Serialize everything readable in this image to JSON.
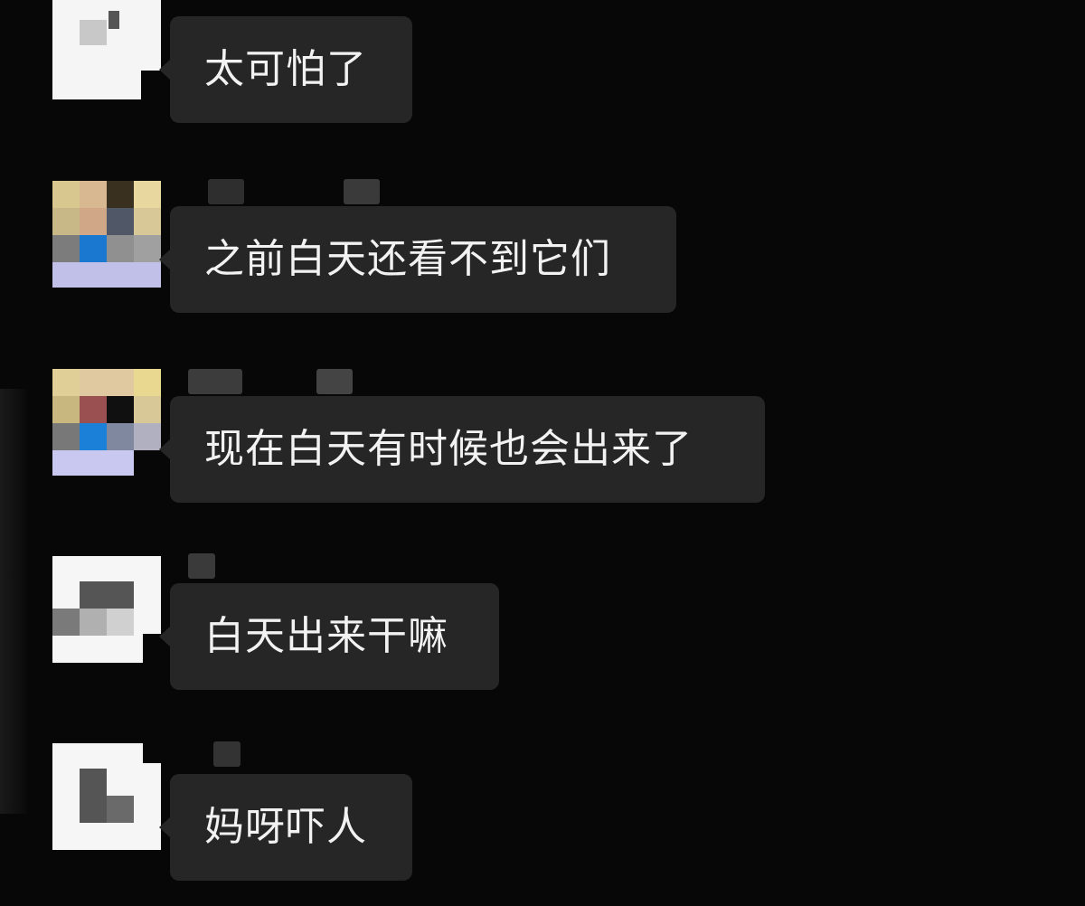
{
  "chat": {
    "messages": [
      {
        "text": "太可怕了",
        "avatar": "pixelated-avatar-1"
      },
      {
        "text": "之前白天还看不到它们",
        "avatar": "pixelated-avatar-2"
      },
      {
        "text": "现在白天有时候也会出来了",
        "avatar": "pixelated-avatar-3"
      },
      {
        "text": "白天出来干嘛",
        "avatar": "pixelated-avatar-4"
      },
      {
        "text": "妈呀吓人",
        "avatar": "pixelated-avatar-5"
      }
    ]
  },
  "colors": {
    "background": "#070707",
    "bubble": "#262626",
    "bubble_text": "#f2f2f2"
  }
}
